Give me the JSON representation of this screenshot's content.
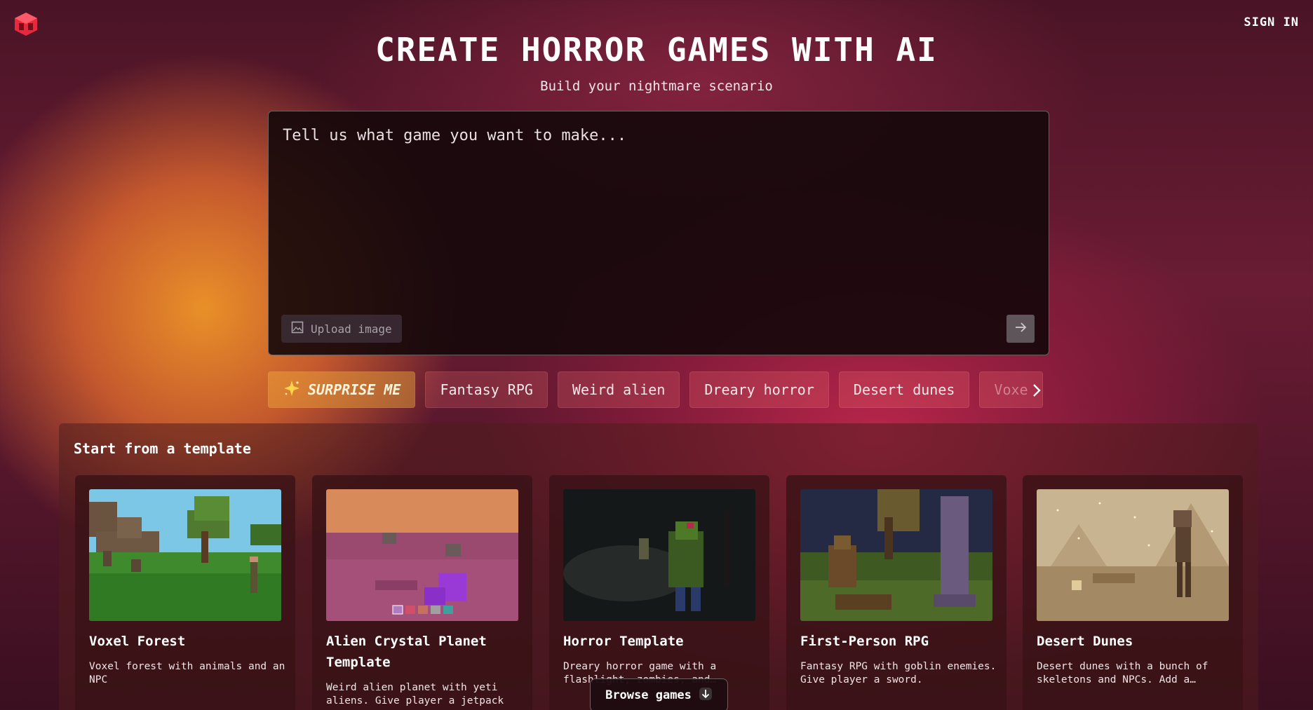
{
  "header": {
    "logo_icon": "cube-logo-icon",
    "sign_in_label": "SIGN IN"
  },
  "hero": {
    "title": "CREATE HORROR GAMES WITH AI",
    "subtitle": "Build your nightmare scenario"
  },
  "prompt": {
    "placeholder": "Tell us what game you want to make...",
    "value": "",
    "upload_label": "Upload image",
    "upload_icon": "image-icon",
    "send_icon": "arrow-right-icon"
  },
  "suggestions": {
    "items": [
      {
        "label": "SURPRISE ME",
        "icon": "sparkle-icon"
      },
      {
        "label": "Fantasy RPG"
      },
      {
        "label": "Weird alien"
      },
      {
        "label": "Dreary horror"
      },
      {
        "label": "Desert dunes"
      },
      {
        "label": "Voxe"
      }
    ],
    "next_icon": "chevron-right-icon"
  },
  "templates": {
    "title": "Start from a template",
    "cards": [
      {
        "title": "Voxel Forest",
        "description": "Voxel forest with animals and an NPC"
      },
      {
        "title": "Alien Crystal Planet Template",
        "description": "Weird alien planet with yeti aliens. Give player a jetpack"
      },
      {
        "title": "Horror Template",
        "description": "Dreary horror game with a flashlight, zombies, and…"
      },
      {
        "title": "First-Person RPG",
        "description": "Fantasy RPG with goblin enemies. Give player a sword."
      },
      {
        "title": "Desert Dunes",
        "description": "Desert dunes with a bunch of skeletons and NPCs. Add a…"
      }
    ]
  },
  "browse": {
    "label": "Browse games",
    "icon": "arrow-down-icon"
  },
  "colors": {
    "accent_red": "#e8283c",
    "surprise_chip": "#f0aa3c"
  }
}
